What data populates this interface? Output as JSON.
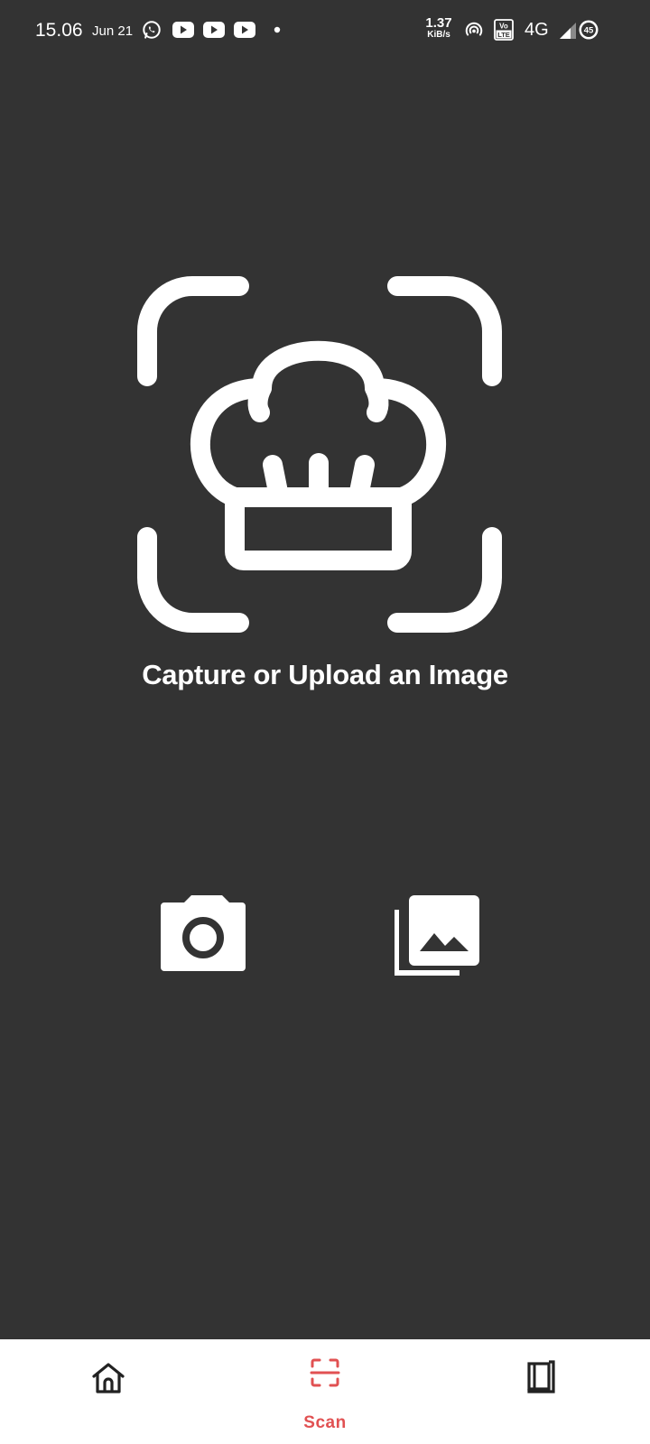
{
  "status_bar": {
    "time": "15.06",
    "date": "Jun 21",
    "net_speed_value": "1.37",
    "net_speed_unit": "KiB/s",
    "network_type": "4G",
    "battery": "45",
    "icons": [
      "whatsapp-icon",
      "youtube-icon",
      "youtube-icon",
      "youtube-icon",
      "dot-icon",
      "hotspot-icon",
      "volte-icon",
      "signal-icon",
      "battery-icon"
    ]
  },
  "main": {
    "hero_icon": "chef-hat-scan-icon",
    "prompt": "Capture or Upload an Image",
    "actions": [
      {
        "name": "camera-button",
        "icon": "camera-icon"
      },
      {
        "name": "gallery-button",
        "icon": "gallery-icon"
      }
    ]
  },
  "bottom_nav": {
    "accent_color": "#e15152",
    "items": [
      {
        "icon": "home-icon",
        "label": ""
      },
      {
        "icon": "scan-icon",
        "label": "Scan"
      },
      {
        "icon": "book-icon",
        "label": ""
      }
    ]
  }
}
